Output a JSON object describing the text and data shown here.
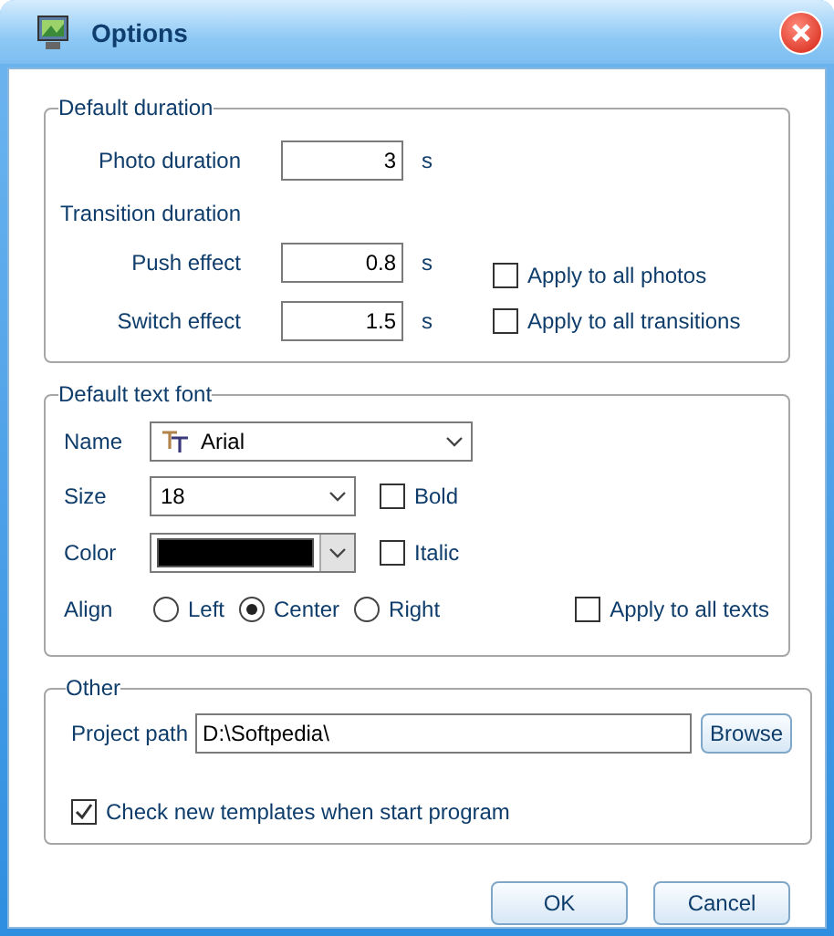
{
  "window": {
    "title": "Options"
  },
  "default_duration": {
    "title": "Default duration",
    "photo": {
      "label": "Photo duration",
      "value": "3",
      "unit": "s"
    },
    "transition_label": "Transition duration",
    "effects": [
      {
        "label": "Push effect",
        "value": "0.8",
        "unit": "s",
        "option": {
          "label": "Apply to all photos",
          "checked": false
        }
      },
      {
        "label": "Switch effect",
        "value": "1.5",
        "unit": "s",
        "option": {
          "label": "Apply to all transitions",
          "checked": false
        }
      }
    ]
  },
  "default_text_font": {
    "title": "Default text font",
    "name": {
      "label": "Name",
      "value": "Arial"
    },
    "size": {
      "label": "Size",
      "value": "18",
      "option": {
        "label": "Bold",
        "checked": false
      }
    },
    "color": {
      "label": "Color",
      "color": "#000000",
      "option": {
        "label": "Italic",
        "checked": false
      }
    },
    "align": {
      "label": "Align",
      "choices": [
        {
          "label": "Left",
          "selected": false
        },
        {
          "label": "Center",
          "selected": true
        },
        {
          "label": "Right",
          "selected": false
        }
      ],
      "option": {
        "label": "Apply to all texts",
        "checked": false
      }
    }
  },
  "other": {
    "title": "Other",
    "path": {
      "label": "Project path",
      "value": "D:\\Softpedia\\",
      "button": "Browse"
    },
    "option": {
      "label": "Check new templates when start program",
      "checked": true
    }
  },
  "buttons": [
    "OK",
    "Cancel"
  ]
}
